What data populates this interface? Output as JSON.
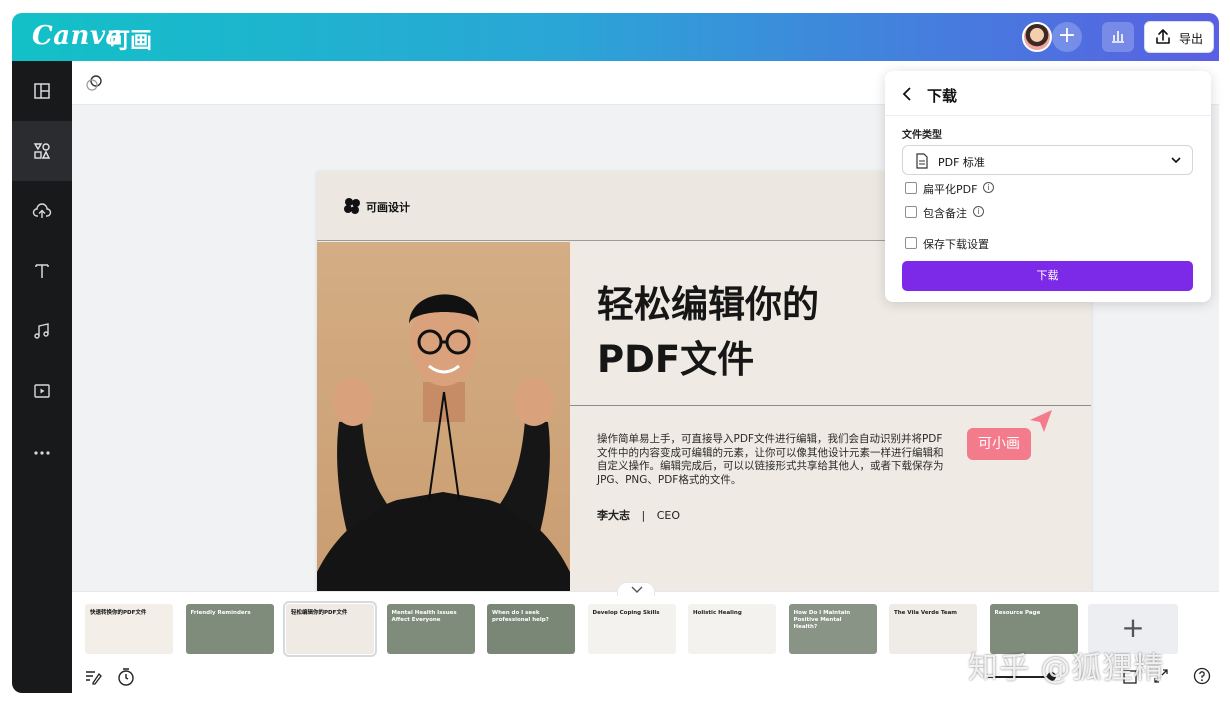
{
  "brand": {
    "logo_text": "Canva",
    "logo_cn": "可画"
  },
  "topbar": {
    "export_label": "导出"
  },
  "download_panel": {
    "title": "下载",
    "file_type_label": "文件类型",
    "file_type_value": "PDF 标准",
    "options": [
      {
        "label": "扁平化PDF",
        "info": true,
        "checked": false
      },
      {
        "label": "包含备注",
        "info": true,
        "checked": false
      },
      {
        "label": "保存下载设置",
        "info": false,
        "checked": false
      }
    ],
    "download_button": "下载"
  },
  "slide": {
    "logo_text": "可画设计",
    "title_line1": "轻松编辑你的",
    "title_line2": "PDF文件",
    "body": "操作简单易上手，可直接导入PDF文件进行编辑，我们会自动识别并将PDF文件中的内容变成可编辑的元素，让你可以像其他设计元素一样进行编辑和自定义操作。编辑完成后，可以以链接形式共享给其他人，或者下载保存为JPG、PNG、PDF格式的文件。",
    "author_name": "李大志",
    "author_sep": "|",
    "author_role": "CEO"
  },
  "collaborator": {
    "name": "可小画"
  },
  "filmstrip": {
    "thumbnails": [
      {
        "title": "快速转换你的PDF文件",
        "bg": "#f3eee8",
        "fg": "#111111"
      },
      {
        "title": "Friendly Reminders",
        "bg": "#7f8b7b",
        "fg": "#ffffff"
      },
      {
        "title": "轻松编辑你的PDF文件",
        "bg": "#efeae4",
        "fg": "#111111"
      },
      {
        "title": "Mental Health Issues Affect Everyone",
        "bg": "#7f8b7b",
        "fg": "#ffffff"
      },
      {
        "title": "When do I seek professional help?",
        "bg": "#7a8676",
        "fg": "#ffffff"
      },
      {
        "title": "Develop Coping Skills",
        "bg": "#f3f2ef",
        "fg": "#222222"
      },
      {
        "title": "Holistic Healing",
        "bg": "#f3f2ef",
        "fg": "#222222"
      },
      {
        "title": "How Do I Maintain Positive Mental Health?",
        "bg": "#8a9486",
        "fg": "#ffffff"
      },
      {
        "title": "The Vila Verde Team",
        "bg": "#efece7",
        "fg": "#222222"
      },
      {
        "title": "Resource Page",
        "bg": "#7f8b7b",
        "fg": "#ffffff"
      }
    ],
    "add_label": "+"
  },
  "watermark": "知乎 @狐狸精"
}
